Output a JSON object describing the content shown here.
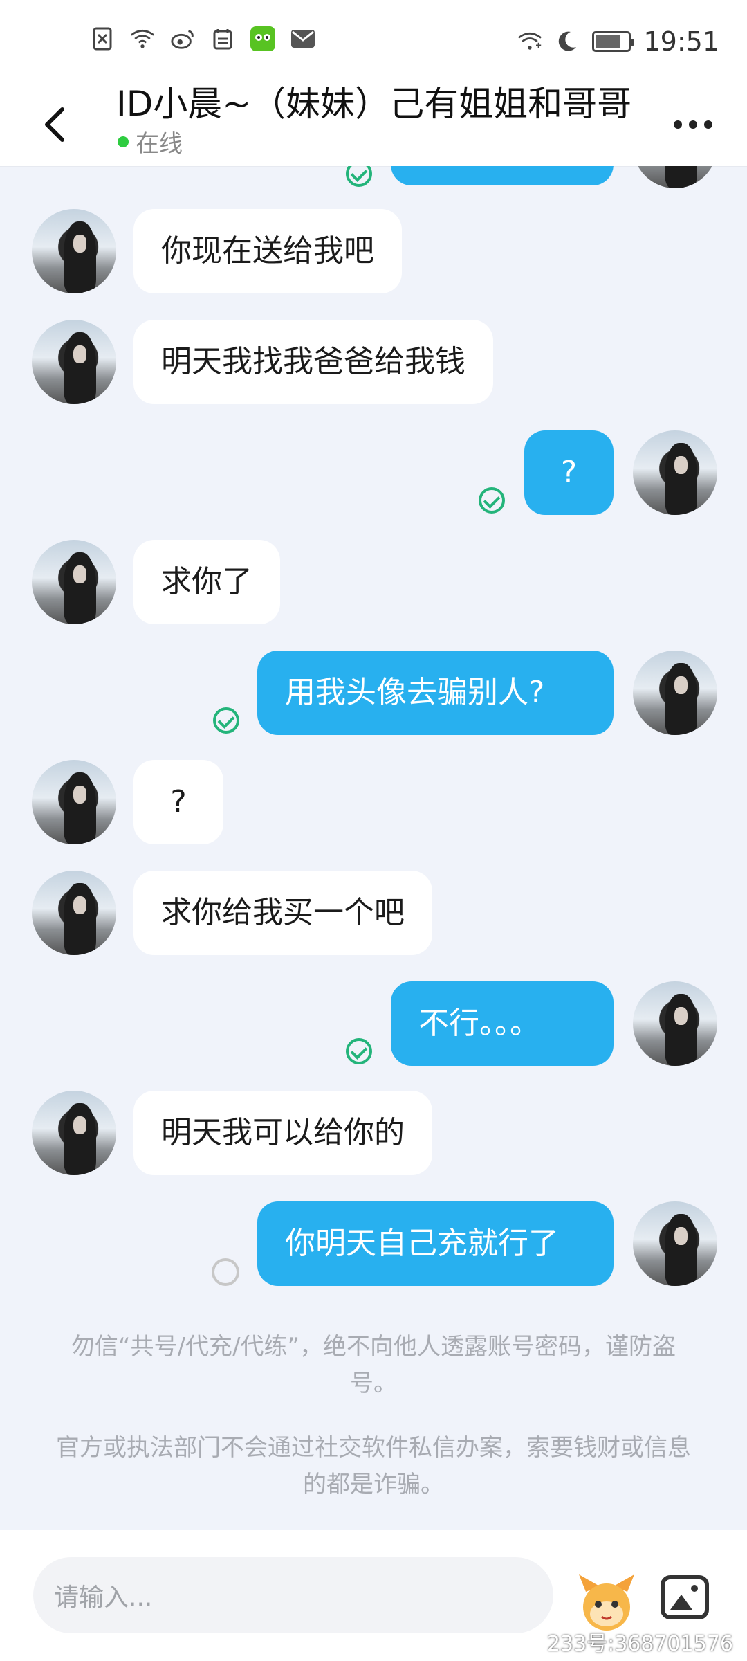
{
  "status_bar": {
    "time": "19:51"
  },
  "header": {
    "title": "ID小晨~（妹妹）己有姐姐和哥哥",
    "online_status": "在线"
  },
  "messages": [
    {
      "side": "in",
      "text": "你现在送给我吧"
    },
    {
      "side": "in",
      "text": "明天我找我爸爸给我钱"
    },
    {
      "side": "out",
      "text": "?",
      "status": "read"
    },
    {
      "side": "in",
      "text": "求你了"
    },
    {
      "side": "out",
      "text": "用我头像去骗别人?",
      "status": "read"
    },
    {
      "side": "in",
      "text": "?"
    },
    {
      "side": "in",
      "text": "求你给我买一个吧"
    },
    {
      "side": "out",
      "text": "不行。。。",
      "status": "read"
    },
    {
      "side": "in",
      "text": "明天我可以给你的"
    },
    {
      "side": "out",
      "text": "你明天自己充就行了",
      "status": "sending"
    }
  ],
  "notices": [
    "勿信“共号/代充/代练”，绝不向他人透露账号密码，谨防盗号。",
    "官方或执法部门不会通过社交软件私信办案，索要钱财或信息的都是诈骗。"
  ],
  "input": {
    "placeholder": "请输入..."
  },
  "watermark": "233号:368701576",
  "colors": {
    "outgoing_bubble": "#28b0ef",
    "incoming_bubble": "#ffffff",
    "read_check": "#23b47a",
    "background": "#f0f3fa"
  },
  "icons": [
    "close-box-icon",
    "wifi-icon",
    "weibo-icon",
    "calendar-icon",
    "app-icon",
    "mail-icon",
    "wifi-plus-icon",
    "moon-icon",
    "battery-icon",
    "back-icon",
    "more-icon",
    "mascot-icon",
    "image-icon"
  ]
}
